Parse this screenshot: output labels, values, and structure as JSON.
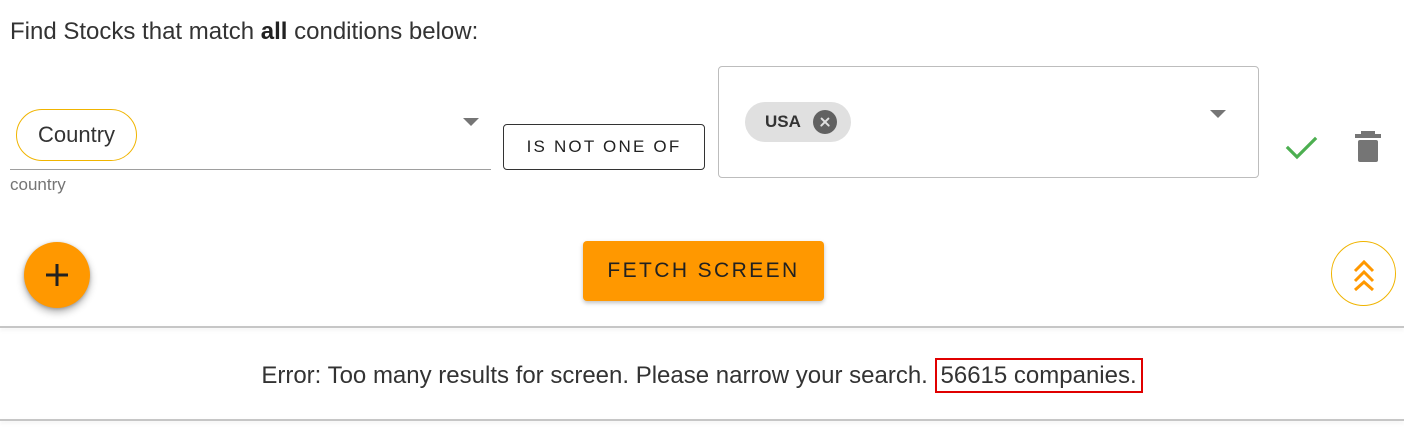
{
  "heading": {
    "prefix": "Find Stocks that match ",
    "bold": "all",
    "suffix": " conditions below:"
  },
  "condition": {
    "field_chip": "Country",
    "field_helper": "country",
    "operator": "IS NOT ONE OF",
    "values": [
      "USA"
    ]
  },
  "actions": {
    "fetch_label": "FETCH SCREEN"
  },
  "error": {
    "message": "Error: Too many results for screen. Please narrow your search. ",
    "count": "56615 companies."
  },
  "colors": {
    "accent": "#ff9800",
    "accent_outline": "#f0b400",
    "confirm": "#4caf50",
    "error_highlight": "#e00000"
  },
  "icons": {
    "add": "plus-icon",
    "confirm": "check-icon",
    "delete": "trash-icon",
    "collapse": "double-chevron-up-icon",
    "chip_remove": "cancel-circle-icon",
    "dropdown": "caret-down-icon"
  }
}
